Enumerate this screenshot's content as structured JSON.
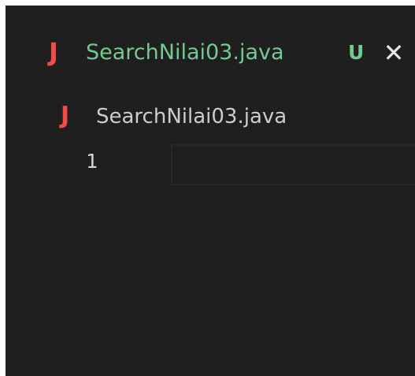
{
  "tab": {
    "icon": "J",
    "title": "SearchNilai03.java",
    "status": "U",
    "close": "✕"
  },
  "breadcrumb": {
    "icon": "J",
    "label": "SearchNilai03.java"
  },
  "editor": {
    "line_numbers": [
      "1"
    ]
  },
  "colors": {
    "background": "#1f1f1f",
    "java_icon": "#f44a4a",
    "untracked": "#73c991",
    "text": "#cccccc"
  }
}
